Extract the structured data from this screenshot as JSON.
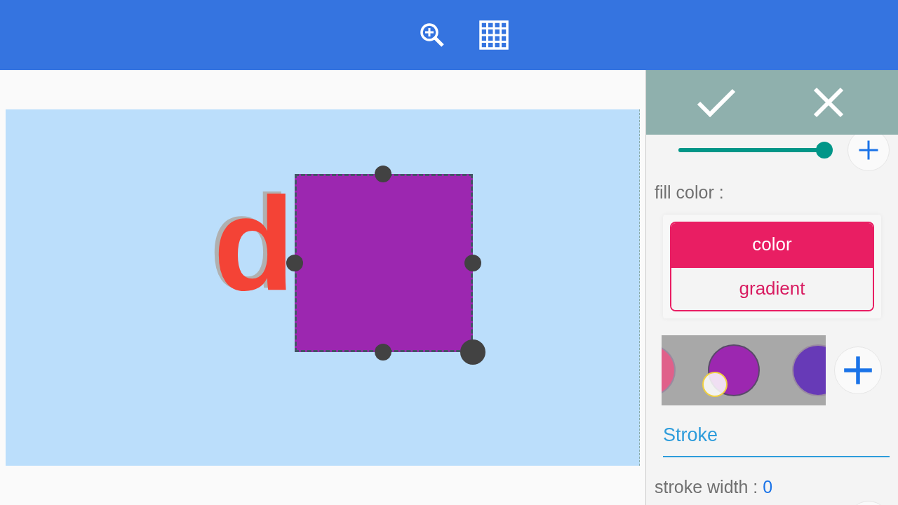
{
  "toolbar": {
    "tools": [
      {
        "kind": "zoom"
      },
      {
        "kind": "grid"
      }
    ]
  },
  "canvas": {
    "text": "d"
  },
  "panel": {
    "actions": [
      {
        "kind": "confirm"
      },
      {
        "kind": "cancel"
      }
    ],
    "opacity_slider": {
      "level": 1
    },
    "fill_label": "fill color :",
    "fill_modes": [
      {
        "label": "color",
        "selected": true
      },
      {
        "label": "gradient",
        "selected": false
      }
    ],
    "swatches": [
      {
        "color": "#e0608a",
        "selected": false
      },
      {
        "color": "#9c27b0",
        "selected": true
      },
      {
        "color": "#673ab7",
        "selected": false
      }
    ],
    "section_tab": "Stroke",
    "stroke_width": {
      "label": "stroke width : ",
      "value": "0"
    }
  }
}
